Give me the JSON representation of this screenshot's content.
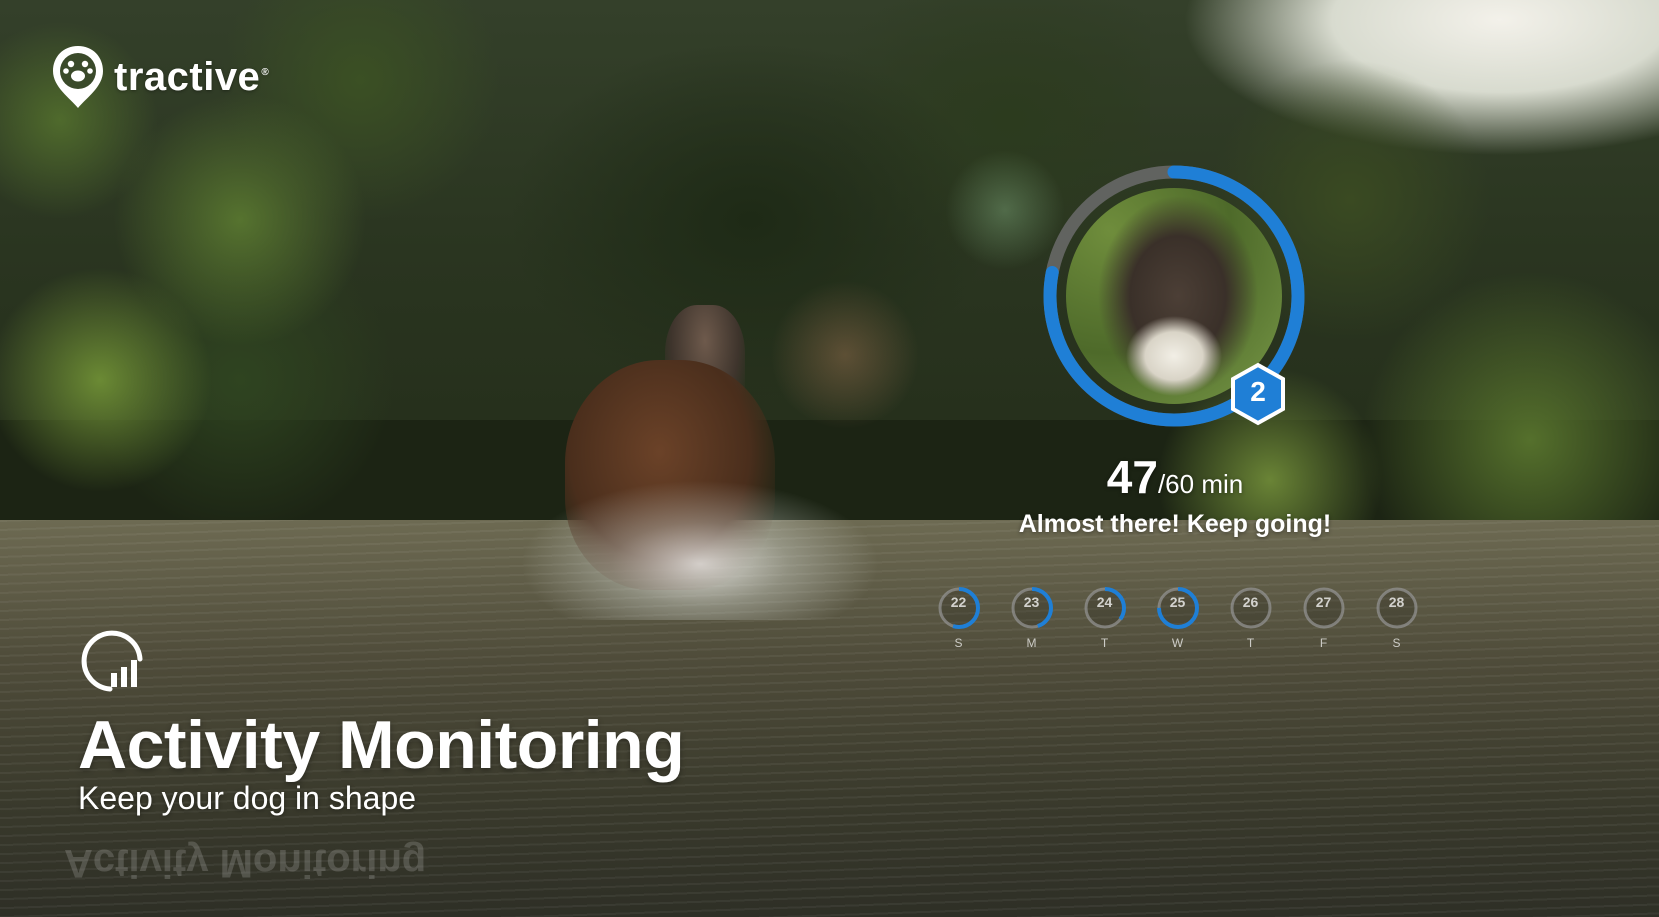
{
  "brand": {
    "name": "tractive",
    "registered": "®"
  },
  "pet": {
    "badge_number": "2",
    "goal_progress_fraction": 0.78
  },
  "activity": {
    "value": "47",
    "goal": "/60 min",
    "message": "Almost there! Keep going!"
  },
  "week": [
    {
      "date": "22",
      "day": "S",
      "progress": 0.55
    },
    {
      "date": "23",
      "day": "M",
      "progress": 0.45
    },
    {
      "date": "24",
      "day": "T",
      "progress": 0.35
    },
    {
      "date": "25",
      "day": "W",
      "progress": 0.75
    },
    {
      "date": "26",
      "day": "T",
      "progress": 0
    },
    {
      "date": "27",
      "day": "F",
      "progress": 0
    },
    {
      "date": "28",
      "day": "S",
      "progress": 0
    }
  ],
  "feature": {
    "title": "Activity Monitoring",
    "subtitle": "Keep your dog in shape"
  },
  "colors": {
    "accent": "#1f7fd6",
    "ring_track": "#6b6b6b"
  }
}
